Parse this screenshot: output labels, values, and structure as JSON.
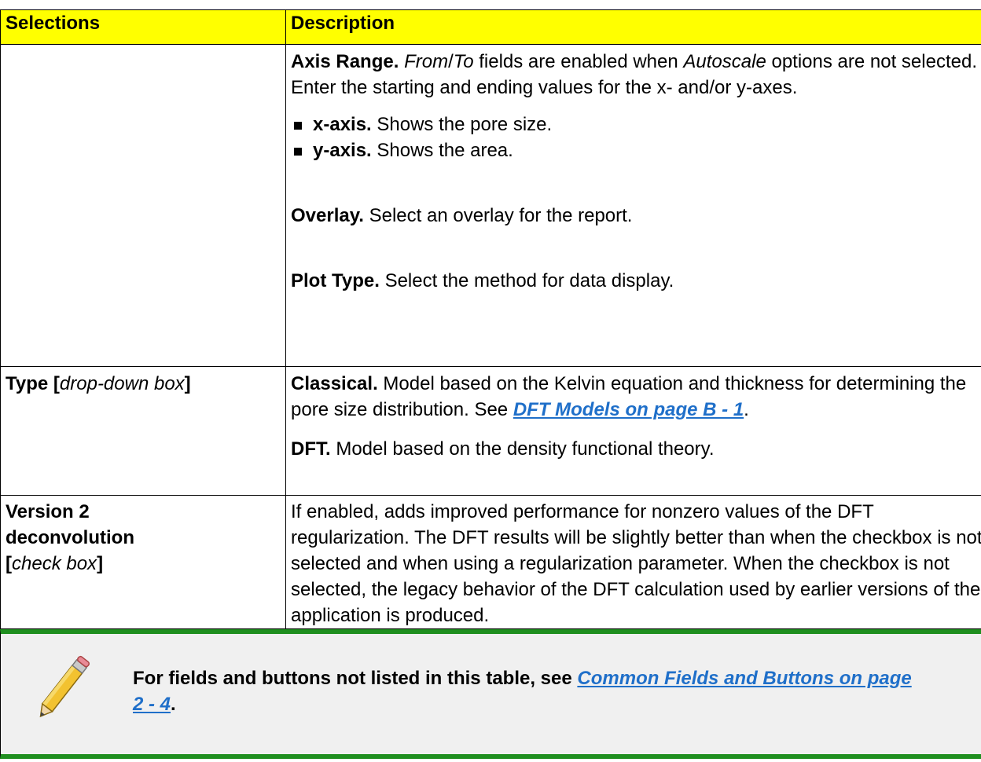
{
  "header": {
    "col1": "Selections",
    "col2": "Description"
  },
  "rows": [
    {
      "axis_range_title": "Axis Range.",
      "axis_from": "From",
      "axis_slash": "/",
      "axis_to": "To",
      "axis_mid": " fields are enabled when ",
      "axis_autoscale": "Autoscale",
      "axis_rest": " options are not selected. Enter the starting and ending values for the x- and/or y-axes.",
      "bullets": [
        {
          "label": "x-axis.",
          "text": " Shows the pore size."
        },
        {
          "label": "y-axis.",
          "text": " Shows the area."
        }
      ],
      "overlay_title": "Overlay.",
      "overlay_text": " Select an overlay for the report.",
      "plot_title": "Plot Type.",
      "plot_text": " Select the method for data display."
    },
    {
      "sel_bold": "Type [",
      "sel_italic": "drop-down box",
      "sel_end": "]",
      "classical_title": "Classical.",
      "classical_text": " Model based on the Kelvin equation and thickness for determining the pore size distribution. See ",
      "classical_link": "DFT Models on page B - 1",
      "classical_end": ".",
      "dft_title": "DFT.",
      "dft_text": " Model based on the density functional theory."
    },
    {
      "sel_line1": "Version 2",
      "sel_line2": "deconvolution",
      "sel_bracket_open": "[",
      "sel_italic": "check box",
      "sel_bracket_close": "]",
      "desc": "If enabled, adds improved performance for nonzero values of the DFT regularization. The DFT results will be slightly better than when the checkbox is not selected and when using a regularization parameter. When the checkbox is not selected, the legacy behavior of the DFT calculation used by earlier versions of the application is produced."
    }
  ],
  "note": {
    "icon": "pencil-icon",
    "text": "For fields and buttons not listed in this table, see ",
    "link": "Common Fields and Buttons on page 2 - 4",
    "end": "."
  },
  "colors": {
    "header_bg": "#ffff00",
    "note_border": "#1f8f1f",
    "link": "#1f6fc9",
    "note_bg": "#f0f0f0"
  }
}
